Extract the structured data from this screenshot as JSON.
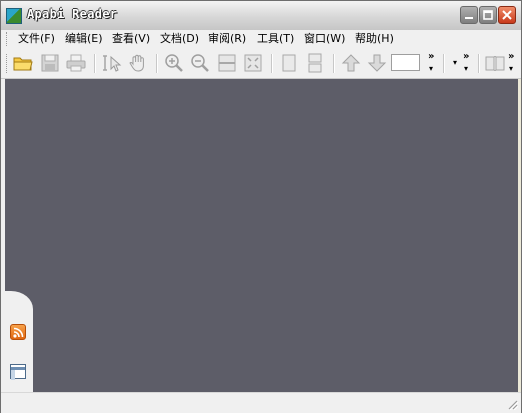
{
  "window": {
    "title": "Apabi Reader"
  },
  "menu": [
    {
      "label": "文件(F)"
    },
    {
      "label": "编辑(E)"
    },
    {
      "label": "查看(V)"
    },
    {
      "label": "文档(D)"
    },
    {
      "label": "审阅(R)"
    },
    {
      "label": "工具(T)"
    },
    {
      "label": "窗口(W)"
    },
    {
      "label": "帮助(H)"
    }
  ],
  "toolbar": {
    "buttons": [
      "open-folder-icon",
      "save-icon",
      "print-icon",
      "select-text-icon",
      "hand-tool-icon",
      "zoom-in-icon",
      "zoom-out-icon",
      "fit-width-icon",
      "fit-page-icon",
      "single-page-icon",
      "continuous-page-icon",
      "previous-page-icon",
      "next-page-icon",
      "book-icon"
    ],
    "page_input_value": "",
    "overflow_glyph": "»",
    "dropdown_glyph": "▾"
  },
  "colors": {
    "workspace": "#5d5d68",
    "accent_rss": "#e67a1e",
    "title_text": "#ffffff"
  }
}
